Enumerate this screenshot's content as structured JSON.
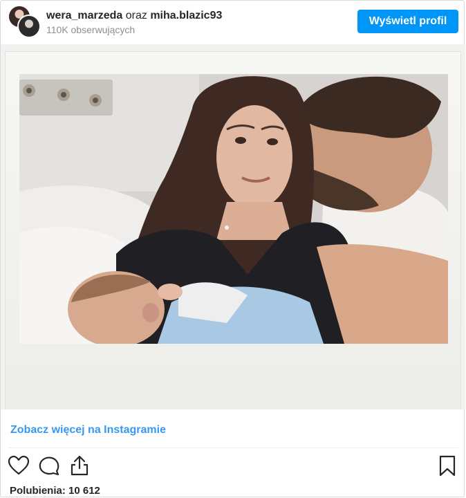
{
  "header": {
    "user1": "wera_marzeda",
    "conjunction": "oraz",
    "user2": "miha.blazic93",
    "followers": "110K obserwujących",
    "view_profile_button": "Wyświetl profil"
  },
  "footer": {
    "see_more_link": "Zobacz więcej na Instagramie",
    "likes_text": "Polubienia: 10 612"
  },
  "icons": [
    "avatar",
    "heart-icon",
    "comment-icon",
    "share-icon",
    "bookmark-icon"
  ],
  "colors": {
    "accent": "#0095f6",
    "link": "#3897f0",
    "muted": "#8e8e8e"
  }
}
